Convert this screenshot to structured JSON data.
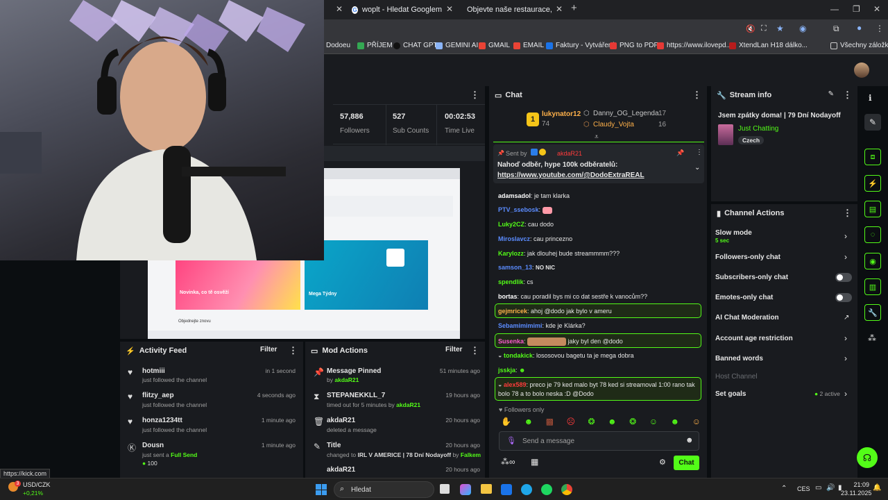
{
  "browser": {
    "tabs": [
      {
        "label": "woplt - Hledat Googlem",
        "icon": "google-icon"
      },
      {
        "label": "Objevte naše restaurace, super",
        "icon": "site-icon"
      }
    ],
    "bookmarks": [
      "Dodoeu",
      "PŘÍJEM",
      "CHAT GPT",
      "GEMINI AI",
      "GMAIL",
      "EMAIL",
      "Faktury - Vytváření",
      "PNG to PDF",
      "https://www.ilovepd...",
      "XtendLan H18 dálko...",
      "Všechny záložky"
    ],
    "status_url": "https://kick.com"
  },
  "stats": {
    "followers_value": "57,886",
    "followers_label": "Followers",
    "subs_value": "527",
    "subs_label": "Sub Counts",
    "time_value": "00:02:53",
    "time_label": "Time Live"
  },
  "chat": {
    "title": "Chat",
    "leaderboard": {
      "first_rank": "1",
      "first_name": "lukynator12",
      "first_count": "74",
      "second_name": "Danny_OG_Legenda",
      "second_count": "17",
      "third_name": "Claudy_Vojta",
      "third_count": "16"
    },
    "pinned": {
      "sent_by": "Sent by",
      "author": "akdaR21",
      "text": "Nahoď odběr, hype 100k odběratelů:",
      "link": "https://www.youtube.com/@DodoExtraREAL"
    },
    "messages": [
      {
        "user": "adamsadol",
        "text": "je tam klarka",
        "color": "#ffffff"
      },
      {
        "user": "PTV_ssebosk",
        "text": "",
        "color": "#5b8cff"
      },
      {
        "user": "Luky2CZ",
        "text": "cau dodo",
        "color": "#53fc18"
      },
      {
        "user": "Miroslavcz",
        "text": "cau princezno",
        "color": "#5b8cff"
      },
      {
        "user": "Karylozz",
        "text": "jak dlouhej bude streammmm???",
        "color": "#53fc18"
      },
      {
        "user": "samson_13",
        "text": "NO NIC",
        "color": "#5b8cff"
      },
      {
        "user": "spendlik",
        "text": "cs",
        "color": "#53fc18"
      },
      {
        "user": "bortas",
        "text": "cau poradil bys mi co dat sestře k vanocům??",
        "color": "#ffffff"
      },
      {
        "user": "gejmricek",
        "text": "ahoj @dodo jak bylo v ameru",
        "color": "#ffb14a"
      },
      {
        "user": "Sebamimimimi",
        "text": "kde je Klárka?",
        "color": "#5b8cff"
      },
      {
        "user": "Susenka",
        "text": "jaky byl den @dodo",
        "color": "#ff5ad0"
      },
      {
        "user": "tondakick",
        "text": "lososovou bagetu ta je mega dobra",
        "color": "#53fc18"
      },
      {
        "user": "jsskja",
        "text": "",
        "color": "#53fc18"
      },
      {
        "user": "alex589",
        "text": "preco je 79 ked malo byt 78 ked si streamoval 1:00 rano tak bolo 78 a to bolo neska :D @Dodo",
        "color": "#ff3b3b"
      }
    ],
    "followers_only": "Followers only",
    "input_placeholder": "Send a message",
    "send_label": "Chat"
  },
  "stream_info": {
    "title": "Stream info",
    "stream_title": "Jsem zpátky doma! | 79 Dní Nodayoff",
    "category": "Just Chatting",
    "language": "Czech"
  },
  "channel_actions": {
    "title": "Channel Actions",
    "slow_mode": "Slow mode",
    "slow_mode_value": "5 sec",
    "followers_only": "Followers-only chat",
    "subscribers_only": "Subscribers-only chat",
    "emotes_only": "Emotes-only chat",
    "ai_moderation": "AI Chat Moderation",
    "account_age": "Account age restriction",
    "banned_words": "Banned words",
    "host_channel": "Host Channel",
    "set_goals": "Set goals",
    "goals_active": "2 active"
  },
  "activity": {
    "title": "Activity Feed",
    "filter": "Filter",
    "items": [
      {
        "user": "hotmiii",
        "desc": "just followed the channel",
        "time": "in 1 second"
      },
      {
        "user": "flitzy_aep",
        "desc": "just followed the channel",
        "time": "4 seconds ago"
      },
      {
        "user": "honza1234tt",
        "desc": "just followed the channel",
        "time": "1 minute ago"
      },
      {
        "user": "Dousn",
        "desc_prefix": "just sent a",
        "desc_gift": "Full Send",
        "amount": "100",
        "time": "1 minute ago"
      }
    ]
  },
  "mod_actions": {
    "title": "Mod Actions",
    "filter": "Filter",
    "items": [
      {
        "title": "Message Pinned",
        "desc_prefix": "by",
        "actor": "akdaR21",
        "time": "51 minutes ago"
      },
      {
        "title": "STEPANEKKLL_7",
        "desc_prefix": "timed out for 5 minutes by",
        "actor": "akdaR21",
        "time": "19 hours ago"
      },
      {
        "title": "akdaR21",
        "desc_prefix": "deleted a message",
        "actor": "",
        "time": "20 hours ago"
      },
      {
        "title": "Title",
        "desc_prefix": "changed to",
        "desc_value": "IRL V AMERICE | 78 Dní Nodayoff",
        "desc_mid": "by",
        "actor": "Falkem",
        "time": "20 hours ago"
      },
      {
        "title": "akdaR21",
        "desc_prefix": "",
        "actor": "",
        "time": "20 hours ago"
      }
    ]
  },
  "taskbar": {
    "stock_name": "USD/CZK",
    "stock_change": "+0,21%",
    "badge": "3",
    "search": "Hledat",
    "lang": "CES",
    "time": "21:09",
    "date": "23.11.2025"
  },
  "preview": {
    "tile1": "Novinka, co tě osvěží",
    "tile2": "Mega Týdny",
    "subhead": "Objednejte znovu"
  }
}
